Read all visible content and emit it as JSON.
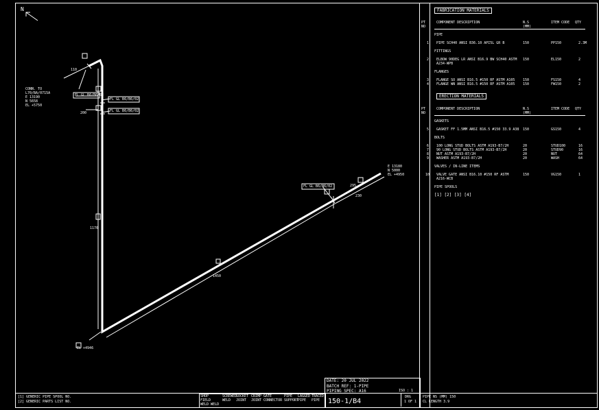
{
  "north": "N",
  "drawing": {
    "left_coords": [
      "CONN. TO",
      "L70/BA/0715A",
      "E 13190",
      "N 5658",
      "EL +5750"
    ],
    "right_coords": [
      "E 13180",
      "N 5000",
      "EL +4950"
    ],
    "bottom_label": "EL +4946",
    "tags": [
      "FL GL B6/B6/02",
      "FL GL B6/B6/02",
      "FL GL B6/B6/02",
      "FL GL B6/B6/02"
    ],
    "dims": [
      "110",
      "200",
      "1170",
      "1450",
      "230",
      "295"
    ],
    "markers": [
      "1",
      "2",
      "3",
      "4"
    ]
  },
  "fabrication": {
    "title": "FABRICATION MATERIALS",
    "col_pt": "PT NO",
    "col_desc": "COMPONENT DESCRIPTION",
    "col_ns": "N.S (MM)",
    "col_code": "ITEM CODE",
    "col_qty": "QTY",
    "sections": [
      {
        "heading": "PIPE",
        "rows": [
          {
            "pt": "1",
            "desc": "PIPE SCH40 ANSI B36.10 API5L GR B",
            "ns": "150",
            "code": "PP150",
            "qty": "2.3M"
          }
        ]
      },
      {
        "heading": "FITTINGS",
        "rows": [
          {
            "pt": "2",
            "desc": "ELBOW 90DEG LR ANSI B16.9 BW SCH40 ASTM A234-WPB",
            "ns": "150",
            "code": "EL150",
            "qty": "2"
          }
        ]
      },
      {
        "heading": "FLANGES",
        "rows": [
          {
            "pt": "3",
            "desc": "FLANGE SO ANSI B16.5 #150 RF ASTM A105",
            "ns": "150",
            "code": "FS150",
            "qty": "4"
          },
          {
            "pt": "4",
            "desc": "FLANGE WN ANSI B16.5 #150 RF ASTM A105",
            "ns": "150",
            "code": "FW150",
            "qty": "2"
          }
        ]
      }
    ]
  },
  "erection": {
    "title": "ERECTION MATERIALS",
    "sections": [
      {
        "heading": "GASKETS",
        "rows": [
          {
            "pt": "5",
            "desc": "GASKET FF 1.5MM ANSI B16.5 #150 33.9 A38",
            "ns": "150",
            "code": "GS150",
            "qty": "4"
          }
        ]
      },
      {
        "heading": "BOLTS",
        "rows": [
          {
            "pt": "6",
            "desc": "100 LONG STUD BOLTS ASTM A193-B7/2H",
            "ns": "20",
            "code": "STUD100",
            "qty": "16"
          },
          {
            "pt": "7",
            "desc": "90 LONG STUD BOLTS ASTM A193-B7/2H",
            "ns": "20",
            "code": "STUD90",
            "qty": "16"
          },
          {
            "pt": "8",
            "desc": "NUT ASTM A193-B7/2H",
            "ns": "20",
            "code": "NUT",
            "qty": "64"
          },
          {
            "pt": "9",
            "desc": "WASHER ASTM A193-B7/2H",
            "ns": "20",
            "code": "WASH",
            "qty": "64"
          }
        ]
      },
      {
        "heading": "VALVES / IN-LINE ITEMS",
        "rows": [
          {
            "pt": "10",
            "desc": "VALVE GATE ANSI B16.10 #150 RF ASTM A216-WCB",
            "ns": "150",
            "code": "VG150",
            "qty": "1"
          }
        ]
      }
    ],
    "spools_heading": "PIPE SPOOLS",
    "spools": "[1] [2] [3] [4]"
  },
  "title_block": {
    "date": "DATE: 20 JUL 2022",
    "batch": "BATCH REF: 1-PIPE",
    "spec": "PIPING SPEC: A16",
    "iso": "ISO : 1",
    "line": "150-1/B4",
    "drg": "DRG",
    "sheet": "1 OF 1",
    "pipe_ns": "PIPE NS (MM)  150",
    "cl_length": "CL LENGTH  3.9",
    "notes": [
      "[1] GENERIC PIPE SPOOL NO.",
      "[2] GENERIC PARTS LIST NO."
    ],
    "legend": [
      "SHOP FIELD WELD WELD",
      "SCREWED WELD",
      "SOCKET JOINT",
      "CRIMP JOINT",
      "GATE CONNECTOR",
      "PIPE SUPPORT",
      "LAGGED PIPE",
      "TRACED PIPE"
    ]
  }
}
